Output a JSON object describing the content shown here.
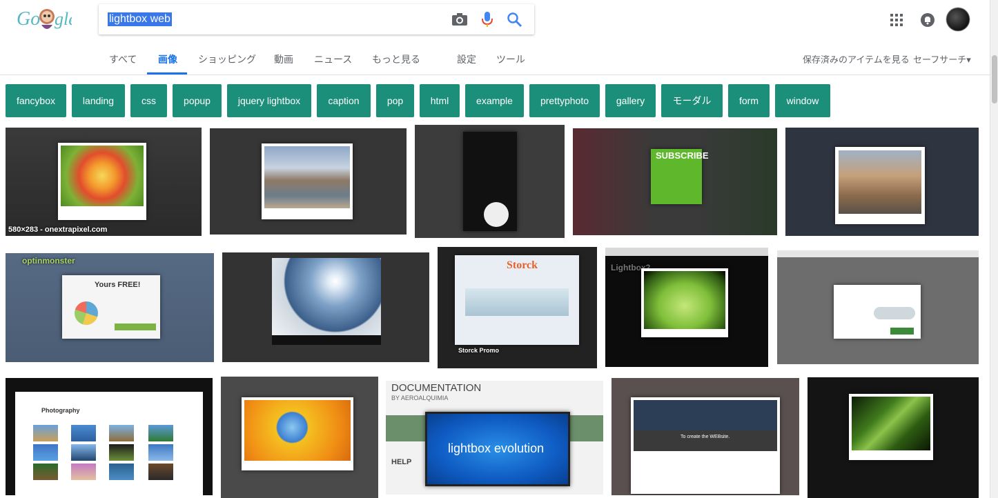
{
  "search": {
    "query": "lightbox web"
  },
  "tabs": [
    {
      "label": "すべて"
    },
    {
      "label": "画像"
    },
    {
      "label": "ショッピング"
    },
    {
      "label": "動画"
    },
    {
      "label": "ニュース"
    },
    {
      "label": "もっと見る"
    },
    {
      "label": "設定"
    },
    {
      "label": "ツール"
    }
  ],
  "right_links": {
    "saved": "保存済みのアイテムを見る",
    "safe_search": "セーフサーチ▾"
  },
  "chips": [
    "fancybox",
    "landing",
    "css",
    "popup",
    "jquery lightbox",
    "caption",
    "pop",
    "html",
    "example",
    "prettyphoto",
    "gallery",
    "モーダル",
    "form",
    "window"
  ],
  "results": {
    "first_caption": "580×283 - onextrapixel.com",
    "overlays": {
      "optinmonster": "optinmonster",
      "yours_free": "Yours FREE!",
      "storck": "Storck",
      "subscribe": "SUBSCRIBE",
      "documentation": "DOCUMENTATION",
      "by": "BY AEROALQUIMIA",
      "help": "HELP",
      "lightbox_evolution": "lightbox evolution",
      "photography": "Photography",
      "create_web": "To create the WEBsite.",
      "lightbox2": "Lightbox2",
      "storck_promo": "Storck Promo"
    }
  },
  "colors": {
    "accent": "#1a73e8",
    "chip": "#1b8f7a"
  }
}
